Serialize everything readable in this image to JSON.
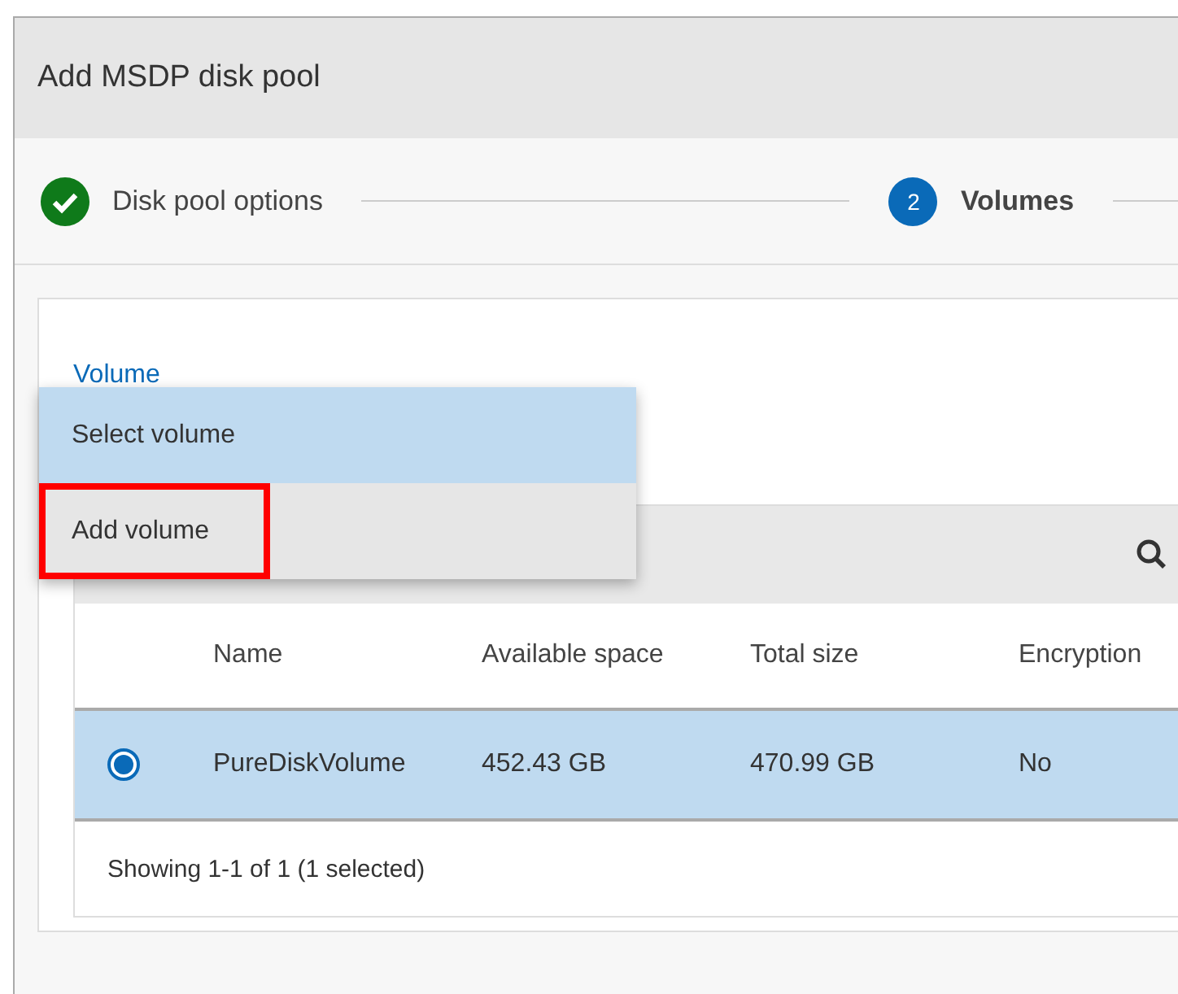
{
  "dialog": {
    "title": "Add MSDP disk pool"
  },
  "steps": [
    {
      "label": "Disk pool options",
      "completed": true,
      "selected": false
    },
    {
      "label": "Volumes",
      "number": "2",
      "completed": false,
      "selected": true
    }
  ],
  "volume_field": {
    "label": "Volume"
  },
  "volume_menu": [
    {
      "label": "Select volume",
      "selected": true,
      "highlighted": false
    },
    {
      "label": "Add volume",
      "selected": false,
      "highlighted": true
    }
  ],
  "table": {
    "columns": [
      "Name",
      "Available space",
      "Total size",
      "Encryption"
    ],
    "rows": [
      {
        "selected": true,
        "cells": [
          "PureDiskVolume",
          "452.43 GB",
          "470.99 GB",
          "No"
        ]
      }
    ],
    "footer": "Showing 1-1 of 1 (1 selected)"
  }
}
